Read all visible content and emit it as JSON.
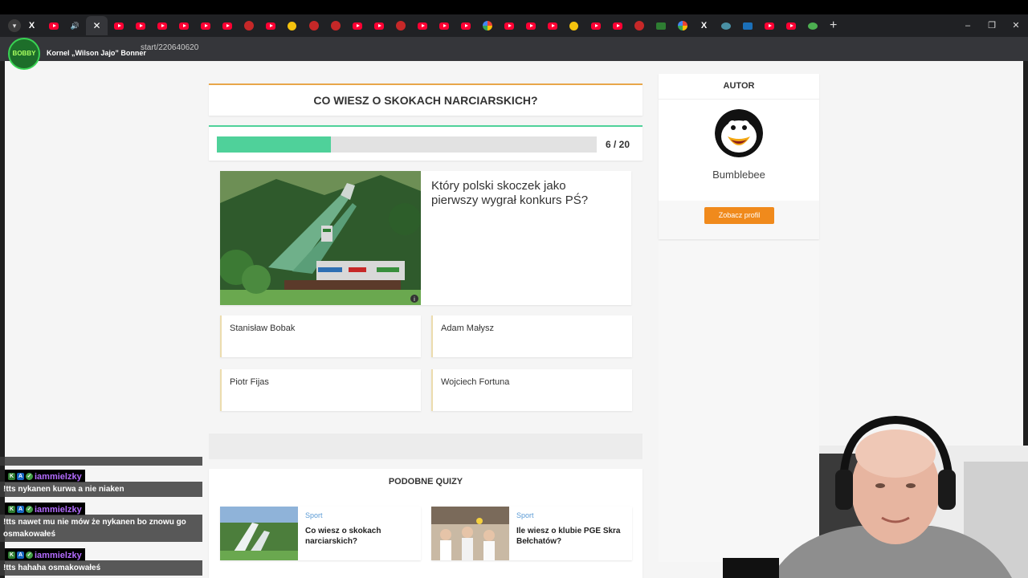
{
  "browser": {
    "url": "start/220640620",
    "channel_name": "Kornel „Wilson Jajo” Bonner",
    "channel_logo_text": "BOBBY",
    "new_tab": "+",
    "window_controls": [
      "–",
      "❐",
      "✕"
    ]
  },
  "quiz": {
    "title": "CO WIESZ O SKOKACH NARCIARSKICH?",
    "progress_text": "6 / 20",
    "progress_fraction": 0.3,
    "question": "Który polski skoczek jako pierwszy wygrał konkurs PŚ?",
    "answers": [
      "Stanisław Bobak",
      "Adam Małysz",
      "Piotr Fijas",
      "Wojciech Fortuna"
    ]
  },
  "similar": {
    "title": "PODOBNE QUIZY",
    "items": [
      {
        "category": "Sport",
        "name": "Co wiesz o skokach narciarskich?"
      },
      {
        "category": "Sport",
        "name": "Ile wiesz o klubie PGE Skra Bełchatów?"
      }
    ]
  },
  "author": {
    "header": "AUTOR",
    "name": "Bumblebee",
    "button": "Zobacz profil"
  },
  "chat": [
    {
      "user": "iammielzky",
      "message": "!tts nykanen kurwa a nie niaken"
    },
    {
      "user": "iammielzky",
      "message": "!tts nawet mu nie mów że nykanen bo znowu go osmakowałeś"
    },
    {
      "user": "iammielzky",
      "message": "!tts hahaha osmakowałeś"
    }
  ],
  "colors": {
    "accent_orange": "#f08a1c",
    "progress_green": "#4fd19a",
    "title_border": "#e8a64a",
    "chat_user": "#b46cff"
  }
}
